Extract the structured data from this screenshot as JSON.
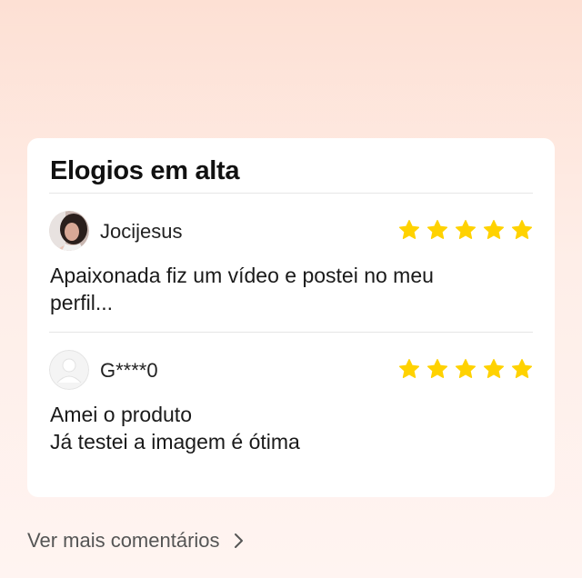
{
  "section": {
    "title": "Elogios em alta",
    "more_link_label": "Ver mais comentários"
  },
  "reviews": [
    {
      "username": "Jocijesus",
      "rating": 5,
      "avatar": "user-photo",
      "text": "Apaixonada fiz um vídeo e postei no meu\nperfil..."
    },
    {
      "username": "G****0",
      "rating": 5,
      "avatar": "default-user-icon",
      "text": "Amei o produto\nJá testei a imagem é ótima"
    }
  ],
  "colors": {
    "star": "#ffd200",
    "background_top": "#fde0d4",
    "card": "#ffffff"
  },
  "icons": {
    "star": "star-icon",
    "chevron": "chevron-right-icon"
  }
}
